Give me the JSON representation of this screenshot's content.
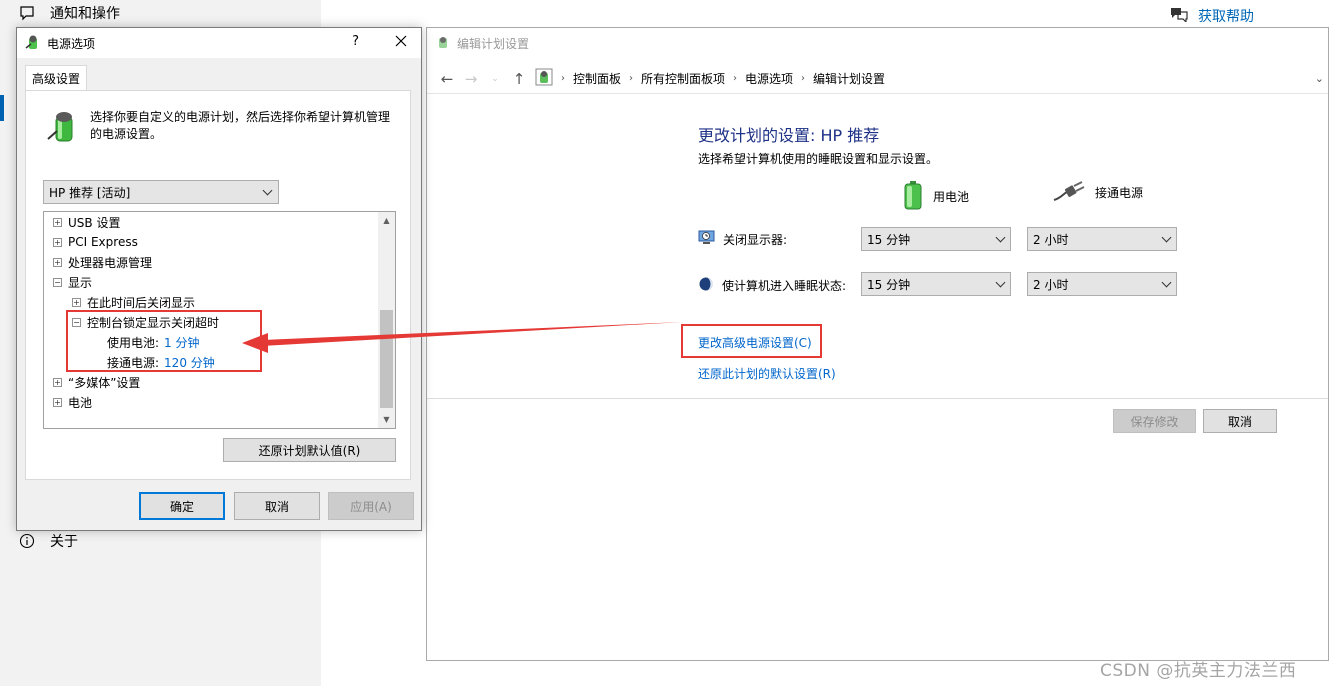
{
  "settings": {
    "notifications_label": "通知和操作",
    "about_label": "关于",
    "help_label": "获取帮助"
  },
  "edit_window": {
    "title": "编辑计划设置",
    "breadcrumb": [
      "控制面板",
      "所有控制面板项",
      "电源选项",
      "编辑计划设置"
    ],
    "heading": "更改计划的设置: HP 推荐",
    "subheading": "选择希望计算机使用的睡眠设置和显示设置。",
    "battery_col": "用电池",
    "plugged_col": "接通电源",
    "display_off_label": "关闭显示器:",
    "sleep_label": "使计算机进入睡眠状态:",
    "display_battery": "15 分钟",
    "display_plugged": "2 小时",
    "sleep_battery": "15 分钟",
    "sleep_plugged": "2 小时",
    "advanced_link": "更改高级电源设置(C)",
    "restore_link": "还原此计划的默认设置(R)",
    "save_button": "保存修改",
    "cancel_button": "取消"
  },
  "power_dialog": {
    "title": "电源选项",
    "help_glyph": "?",
    "tab_label": "高级设置",
    "description": "选择你要自定义的电源计划，然后选择你希望计算机管理的电源设置。",
    "plan_selected": "HP 推荐 [活动]",
    "tree": [
      {
        "toggle": "+",
        "label": "USB 设置"
      },
      {
        "toggle": "+",
        "label": "PCI Express"
      },
      {
        "toggle": "+",
        "label": "处理器电源管理"
      },
      {
        "toggle": "−",
        "label": "显示"
      },
      {
        "toggle": "+",
        "label": "在此时间后关闭显示"
      },
      {
        "toggle": "−",
        "label": "控制台锁定显示关闭超时"
      },
      {
        "toggle": "",
        "label": "使用电池:",
        "value": "1 分钟"
      },
      {
        "toggle": "",
        "label": "接通电源:",
        "value": "120 分钟"
      },
      {
        "toggle": "+",
        "label": "“多媒体”设置"
      },
      {
        "toggle": "+",
        "label": "电池"
      }
    ],
    "restore_button": "还原计划默认值(R)",
    "ok_button": "确定",
    "cancel_button": "取消",
    "apply_button": "应用(A)"
  },
  "annotation_color": "#e53935",
  "watermark": "CSDN @抗英主力法兰西"
}
